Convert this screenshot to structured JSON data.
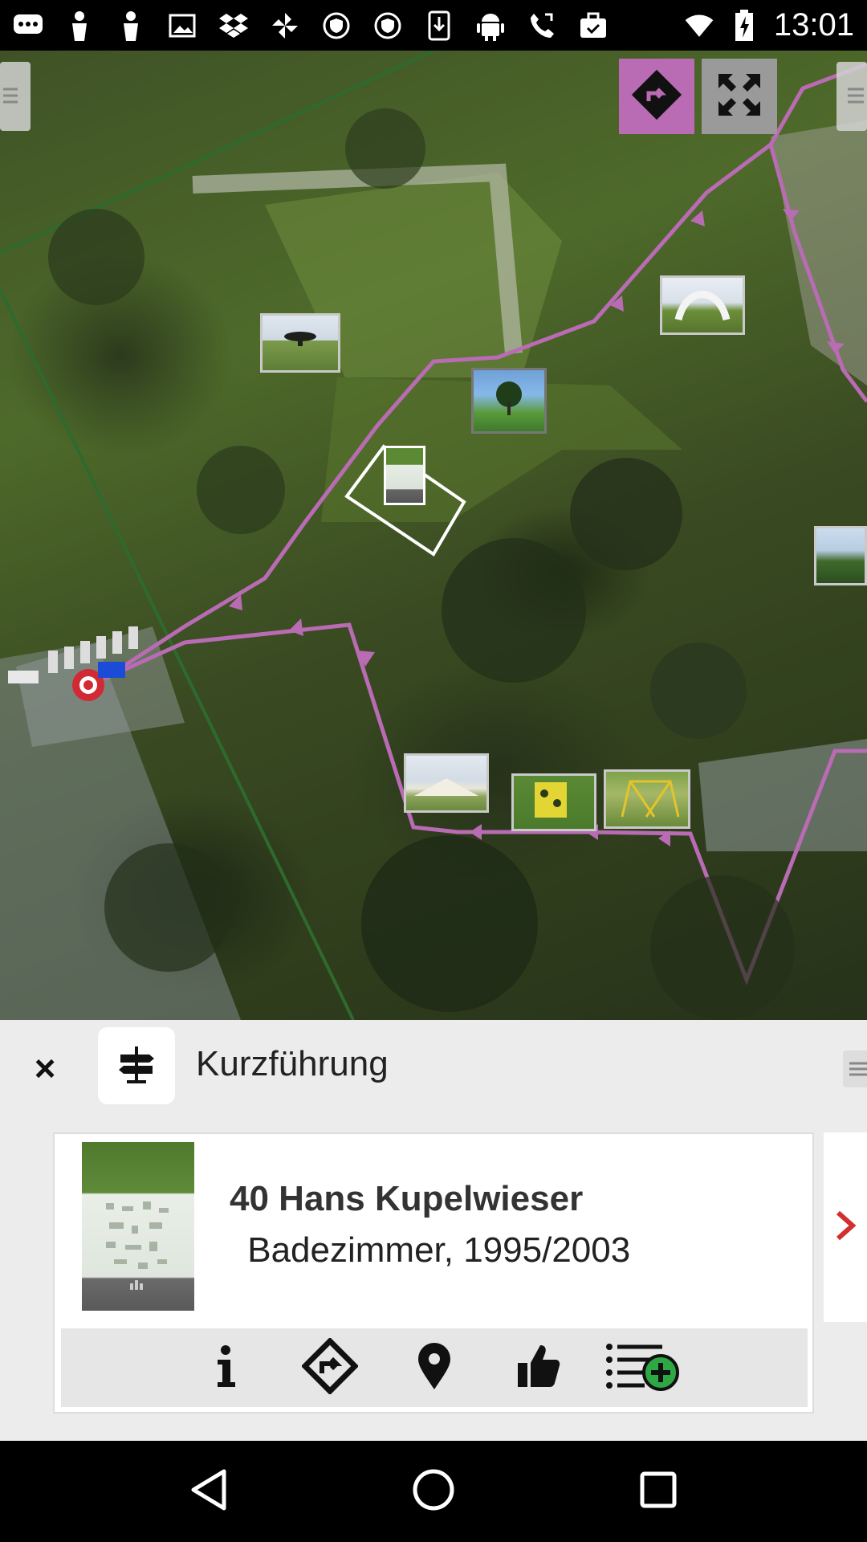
{
  "status_bar": {
    "time": "13:01",
    "icons": [
      "message-icon",
      "person-icon",
      "person-icon",
      "image-icon",
      "dropbox-icon",
      "pinwheel-icon",
      "shield-icon",
      "shield-icon",
      "download-icon",
      "android-icon",
      "phone-icon",
      "briefcase-icon",
      "wifi-icon",
      "battery-charging-icon"
    ]
  },
  "map": {
    "route_color": "#b96bb4",
    "buttons": [
      "route-icon",
      "expand-icon"
    ]
  },
  "tour": {
    "title": "Kurzführung",
    "close_label": "×",
    "icon": "signpost-icon"
  },
  "card": {
    "title": "40 Hans Kupelwieser",
    "subtitle": " Badezimmer, 1995/2003",
    "actions": [
      "info-icon",
      "route-icon",
      "location-pin-icon",
      "thumbs-up-icon",
      "add-to-list-icon"
    ],
    "next_icon": "chevron-right-icon",
    "next_color": "#d32f2f"
  },
  "nav_bar": {
    "buttons": [
      "back-icon",
      "home-icon",
      "recents-icon"
    ]
  }
}
